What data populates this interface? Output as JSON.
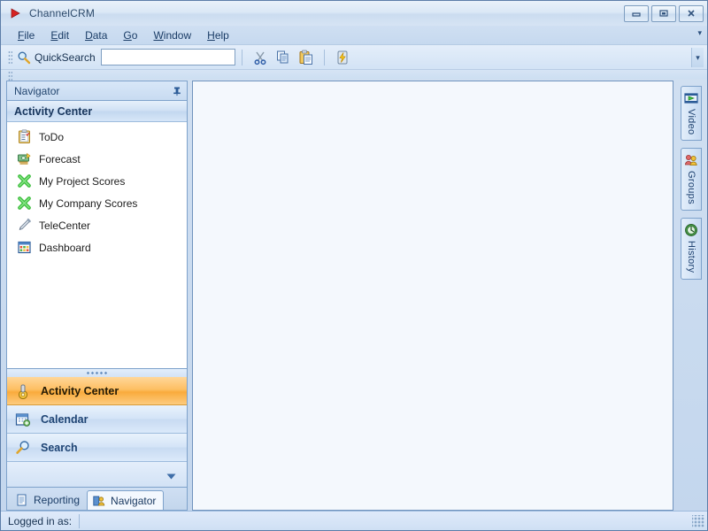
{
  "window": {
    "title": "ChannelCRM",
    "app_icon": "play-triangle-icon",
    "controls": {
      "minimize": "minimize-icon",
      "restore": "restore-icon",
      "close": "close-icon"
    }
  },
  "menubar": {
    "items": [
      {
        "label": "File",
        "accel": "F",
        "rest": "ile"
      },
      {
        "label": "Edit",
        "accel": "E",
        "rest": "dit"
      },
      {
        "label": "Data",
        "accel": "D",
        "rest": "ata"
      },
      {
        "label": "Go",
        "accel": "G",
        "rest": "o"
      },
      {
        "label": "Window",
        "accel": "W",
        "rest": "indow"
      },
      {
        "label": "Help",
        "accel": "H",
        "rest": "elp"
      }
    ],
    "overflow": "▾"
  },
  "toolbar": {
    "quicksearch_label": "QuickSearch",
    "quicksearch_value": "",
    "quicksearch_placeholder": "",
    "buttons": [
      {
        "name": "cut-button",
        "icon": "scissors-icon"
      },
      {
        "name": "copy-button",
        "icon": "copy-documents-icon"
      },
      {
        "name": "paste-button",
        "icon": "clipboard-paste-icon"
      },
      {
        "name": "quick-action-button",
        "icon": "lightning-bolt-icon"
      }
    ],
    "overflow": "▾"
  },
  "navigator": {
    "header_title": "Navigator",
    "pin_icon": "pushpin-icon",
    "group_header": "Activity Center",
    "items": [
      {
        "label": "ToDo",
        "icon": "clipboard-checklist-icon"
      },
      {
        "label": "Forecast",
        "icon": "money-forecast-icon"
      },
      {
        "label": "My Project Scores",
        "icon": "green-x-icon"
      },
      {
        "label": "My Company Scores",
        "icon": "green-x-icon"
      },
      {
        "label": "TeleCenter",
        "icon": "pen-phone-icon"
      },
      {
        "label": "Dashboard",
        "icon": "dashboard-grid-icon"
      }
    ],
    "buttons": [
      {
        "label": "Activity Center",
        "icon": "gear-person-icon",
        "selected": true
      },
      {
        "label": "Calendar",
        "icon": "calendar-icon",
        "selected": false
      },
      {
        "label": "Search",
        "icon": "magnifier-icon",
        "selected": false
      }
    ],
    "overflow": "▾",
    "tabs": [
      {
        "label": "Reporting",
        "icon": "report-document-icon",
        "active": false
      },
      {
        "label": "Navigator",
        "icon": "navigator-people-icon",
        "active": true
      }
    ]
  },
  "sidetabs": [
    {
      "label": "Video",
      "icon": "video-film-icon"
    },
    {
      "label": "Groups",
      "icon": "groups-people-icon"
    },
    {
      "label": "History",
      "icon": "history-clock-icon"
    }
  ],
  "statusbar": {
    "label": "Logged in as:",
    "value": ""
  },
  "colors": {
    "accent_blue": "#1a3c66",
    "selected_orange": "#f9ab3c",
    "frame_border": "#5c7da8",
    "content_bg": "#f4f8fd"
  }
}
